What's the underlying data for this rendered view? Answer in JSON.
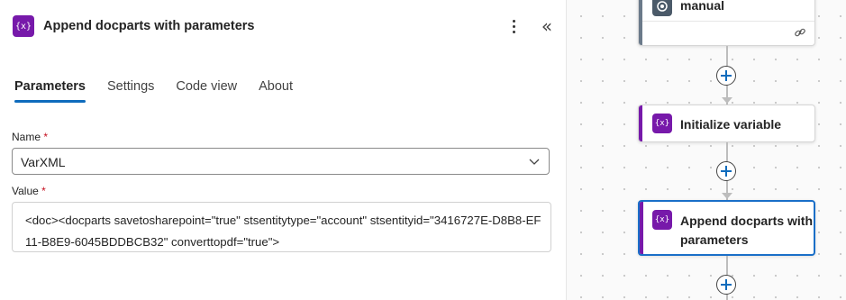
{
  "panel": {
    "title": "Append docparts with parameters",
    "icon": "variable-icon",
    "icon_glyph": "{x}",
    "accent_color": "#7719aa",
    "more_icon": "more-vertical-icon",
    "collapse_icon": "double-chevron-left-icon",
    "collapse_glyph": "«"
  },
  "tabs": [
    {
      "label": "Parameters",
      "active": true
    },
    {
      "label": "Settings",
      "active": false
    },
    {
      "label": "Code view",
      "active": false
    },
    {
      "label": "About",
      "active": false
    }
  ],
  "fields": {
    "name": {
      "label": "Name",
      "required_mark": "*",
      "value": "VarXML"
    },
    "value": {
      "label": "Value",
      "required_mark": "*",
      "value": "<doc><docparts savetosharepoint=\"true\" stsentitytype=\"account\" stsentityid=\"3416727E-D8B8-EF11-B8E9-6045BDDBCB32\" converttopdf=\"true\">"
    }
  },
  "canvas": {
    "nodes": [
      {
        "id": "manual",
        "label": "manual",
        "icon": "manual-trigger-icon",
        "stripe_color": "#6b7a8a"
      },
      {
        "id": "init",
        "label": "Initialize variable",
        "icon": "variable-icon",
        "icon_glyph": "{x}"
      },
      {
        "id": "append",
        "label": "Append docparts with parameters",
        "icon": "variable-icon",
        "icon_glyph": "{x}",
        "selected": true
      }
    ],
    "link_icon": "link-icon",
    "insert_step_icon": "plus-icon",
    "selection_color": "#1a6fc8"
  }
}
